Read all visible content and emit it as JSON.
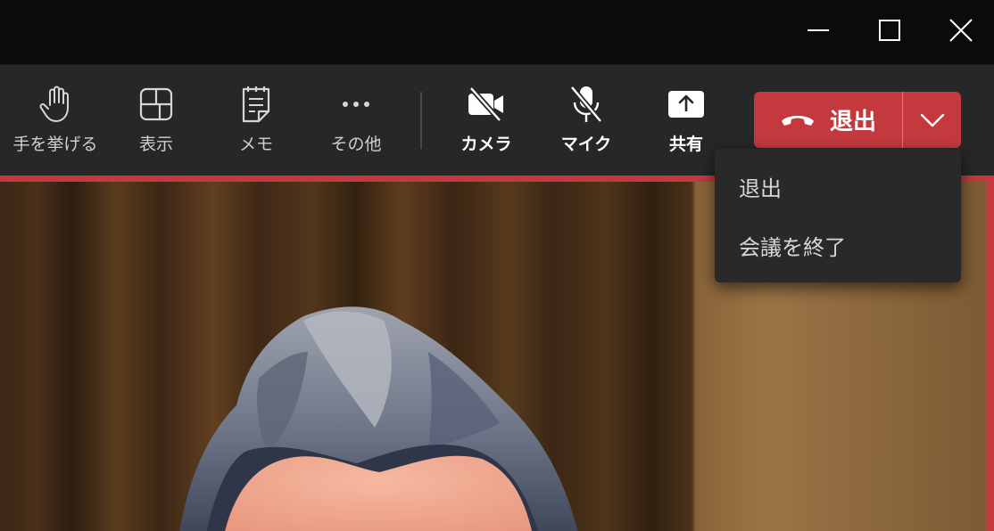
{
  "toolbar": {
    "raise_hand": "手を挙げる",
    "view": "表示",
    "notes": "メモ",
    "more": "その他",
    "camera": "カメラ",
    "mic": "マイク",
    "share": "共有"
  },
  "leave_button": {
    "label": "退出",
    "color": "#c4393d"
  },
  "leave_menu": {
    "items": [
      "退出",
      "会議を終了"
    ]
  },
  "icons": {
    "minimize": "minimize-icon",
    "maximize": "maximize-icon",
    "close": "close-icon",
    "raise_hand": "hand-icon",
    "view": "layout-icon",
    "notes": "notes-icon",
    "more": "more-icon",
    "camera": "camera-off-icon",
    "mic": "mic-off-icon",
    "share": "share-icon",
    "leave": "phone-hangup-icon",
    "dropdown": "chevron-down-icon"
  }
}
